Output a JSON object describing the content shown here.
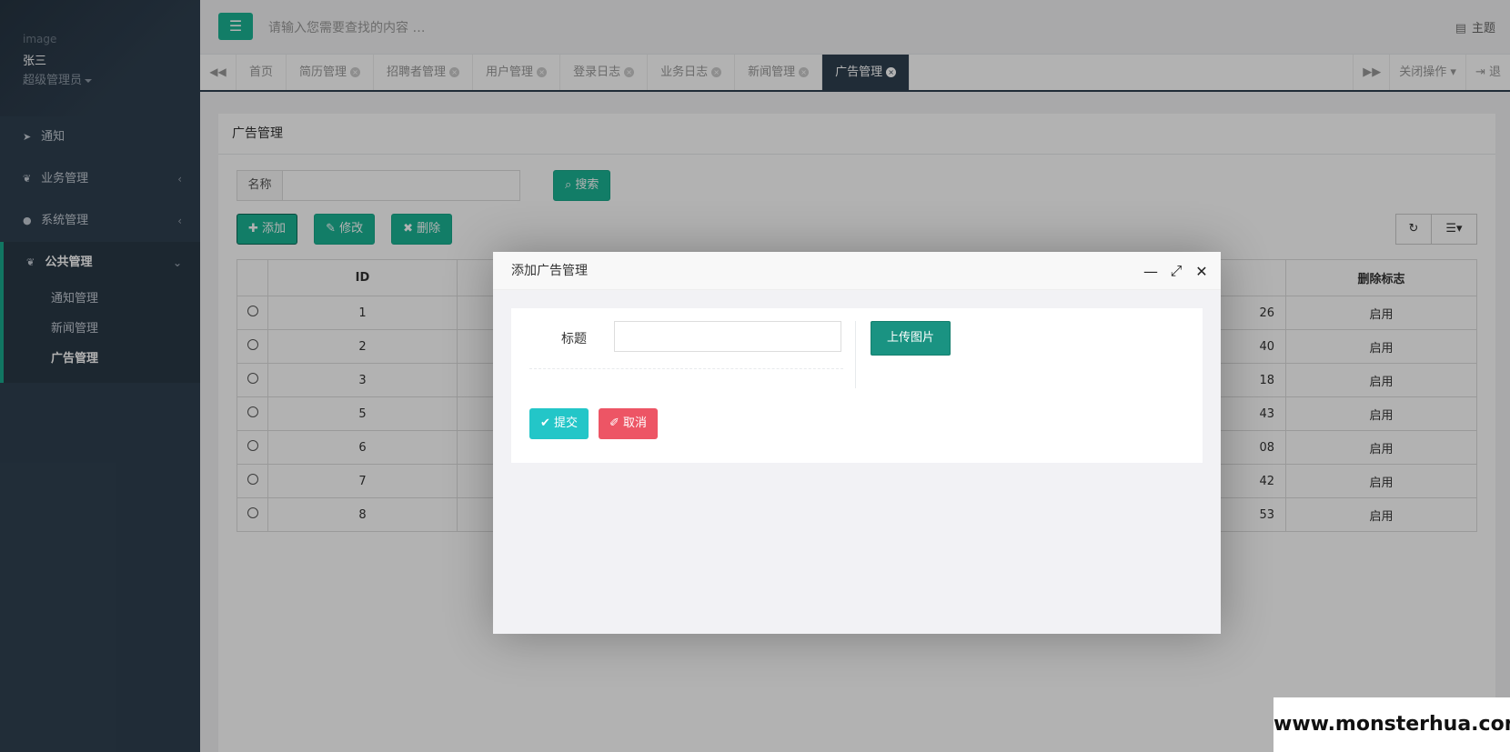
{
  "sidebar": {
    "image_alt": "image",
    "user_name": "张三",
    "user_role": "超级管理员",
    "menu": [
      {
        "label": "通知",
        "icon": "paper-plane-icon"
      },
      {
        "label": "业务管理",
        "icon": "leaf-icon"
      },
      {
        "label": "系统管理",
        "icon": "user-icon"
      }
    ],
    "group": {
      "label": "公共管理",
      "icon": "leaf-icon",
      "items": [
        {
          "label": "通知管理"
        },
        {
          "label": "新闻管理"
        },
        {
          "label": "广告管理"
        }
      ]
    }
  },
  "topbar": {
    "search_placeholder": "请输入您需要查找的内容 …",
    "theme_label": "主题"
  },
  "tabs": {
    "items": [
      "首页",
      "简历管理",
      "招聘者管理",
      "用户管理",
      "登录日志",
      "业务日志",
      "新闻管理",
      "广告管理"
    ],
    "active_index": 7,
    "close_ops_label": "关闭操作",
    "logout_label": "退"
  },
  "page": {
    "title": "广告管理",
    "search_label": "名称",
    "search_button": "搜索",
    "add_button": "添加",
    "edit_button": "修改",
    "delete_button": "删除"
  },
  "table": {
    "columns": [
      "ID",
      "删除标志"
    ],
    "rows": [
      {
        "id": "1",
        "time_tail": "26",
        "flag": "启用"
      },
      {
        "id": "2",
        "time_tail": "40",
        "flag": "启用"
      },
      {
        "id": "3",
        "time_tail": "18",
        "flag": "启用"
      },
      {
        "id": "5",
        "time_tail": "43",
        "flag": "启用"
      },
      {
        "id": "6",
        "time_tail": "08",
        "flag": "启用"
      },
      {
        "id": "7",
        "time_tail": "42",
        "flag": "启用"
      },
      {
        "id": "8",
        "time_tail": "53",
        "flag": "启用"
      }
    ]
  },
  "modal": {
    "title": "添加广告管理",
    "field_label": "标题",
    "field_value": "",
    "upload_button": "上传图片",
    "submit_button": "提交",
    "cancel_button": "取消"
  },
  "watermark": "www.monsterhua.com",
  "colors": {
    "sidebar_bg": "#2f4050",
    "primary": "#1ab394",
    "info": "#23c6c8",
    "danger": "#ed5565"
  }
}
